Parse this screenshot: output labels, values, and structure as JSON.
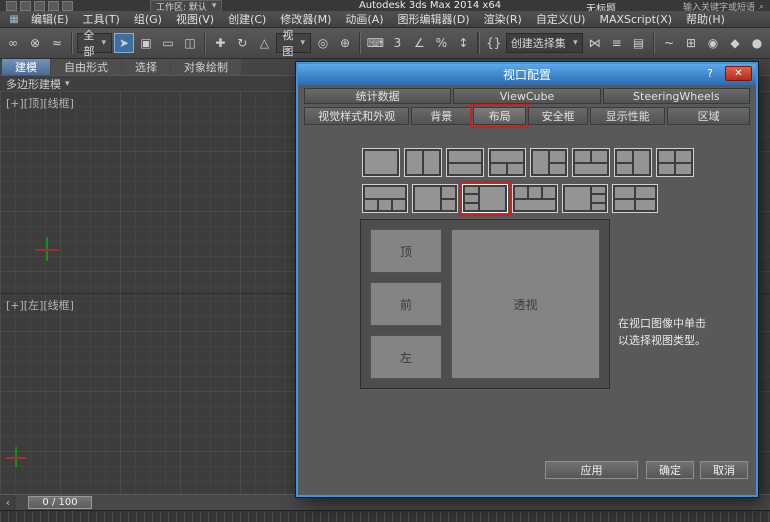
{
  "titlebar": {
    "workspace": "工作区: 默认",
    "title": "Autodesk 3ds Max 2014 x64",
    "doc": "无标题",
    "search_placeholder": "输入关键字或短语"
  },
  "menubar": {
    "items": [
      "编辑(E)",
      "工具(T)",
      "组(G)",
      "视图(V)",
      "创建(C)",
      "修改器(M)",
      "动画(A)",
      "图形编辑器(D)",
      "渲染(R)",
      "自定义(U)",
      "MAXScript(X)",
      "帮助(H)"
    ]
  },
  "toolbar": {
    "filter_dropdown": "全部",
    "coord_dropdown": "视图",
    "selection_set": "创建选择集"
  },
  "ribbon": {
    "tabs": [
      "建模",
      "自由形式",
      "选择",
      "对象绘制"
    ],
    "subtab": "多边形建模"
  },
  "viewport": {
    "top_label": "[+][顶][线框]",
    "left_label": "[+][左][线框]"
  },
  "timeline": {
    "value": "0 / 100"
  },
  "dialog": {
    "title": "视口配置",
    "help_label": "?",
    "close_label": "✕",
    "tabs_row1": [
      "统计数据",
      "ViewCube",
      "SteeringWheels"
    ],
    "tabs_row2": [
      "视觉样式和外观",
      "背景",
      "布局",
      "安全框",
      "显示性能",
      "区域"
    ],
    "preview_panes": {
      "top": "顶",
      "front": "前",
      "left": "左",
      "persp": "透视"
    },
    "hint_line1": "在视口图像中单击",
    "hint_line2": "以选择视图类型。",
    "apply": "应用",
    "ok": "确定",
    "cancel": "取消"
  },
  "icons": {
    "app": "▦",
    "link": "∞",
    "unlink": "⊗",
    "bind": "≈",
    "select": "➤",
    "by_name": "▣",
    "rect": "▭",
    "crossing": "◫",
    "move": "✚",
    "rotate": "↻",
    "scale": "△",
    "pivot": "◎",
    "manipulate": "⊕",
    "keyboard": "⌨",
    "snap3": "3",
    "angle": "∠",
    "percent": "%",
    "spinner": "↕",
    "sets": "{}",
    "mirror": "⋈",
    "align": "≡",
    "layers": "▤",
    "curve": "~",
    "schematic": "⊞",
    "material": "◉",
    "rsetup": "◆",
    "render": "●",
    "dropdown": "▾",
    "search": "⌕",
    "prev": "‹"
  },
  "colors": {
    "annotation_red": "#c92121",
    "dialog_border_blue": "#3f93dc"
  }
}
